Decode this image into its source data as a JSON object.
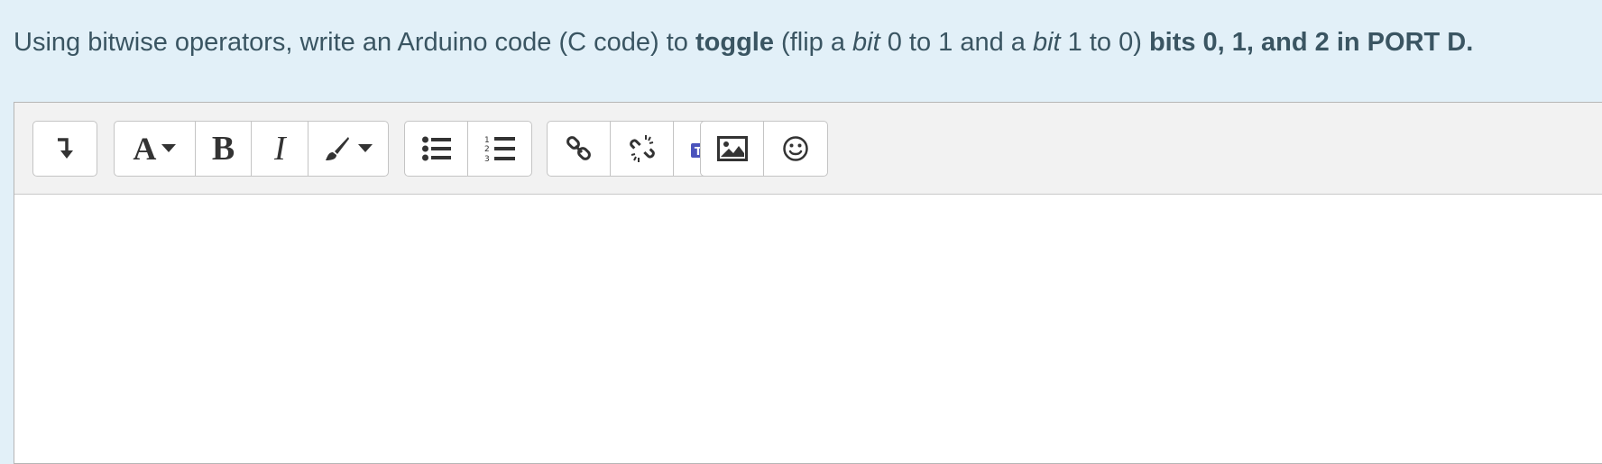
{
  "question": {
    "part1": "Using bitwise operators, write an Arduino code (C code) to ",
    "bold1": "toggle",
    "part2": " (flip a ",
    "italic1": "bit",
    "part3": " 0 to 1 and a ",
    "italic2": "bit",
    "part4": " 1 to 0) ",
    "bold2": "bits 0, 1, and 2 in PORT D."
  },
  "toolbar": {
    "icons": [
      "toolbar-toggle-icon",
      "font-icon",
      "bold-icon",
      "italic-icon",
      "paintbrush-icon",
      "unordered-list-icon",
      "ordered-list-icon",
      "link-icon",
      "unlink-icon",
      "teams-icon",
      "image-icon",
      "emoji-icon"
    ],
    "font_label": "A",
    "bold_label": "B",
    "italic_label": "I"
  },
  "editor": {
    "content": ""
  },
  "colors": {
    "page_bg": "#e2f0f8",
    "text": "#3a5562",
    "teams": "#5b5fc7"
  }
}
